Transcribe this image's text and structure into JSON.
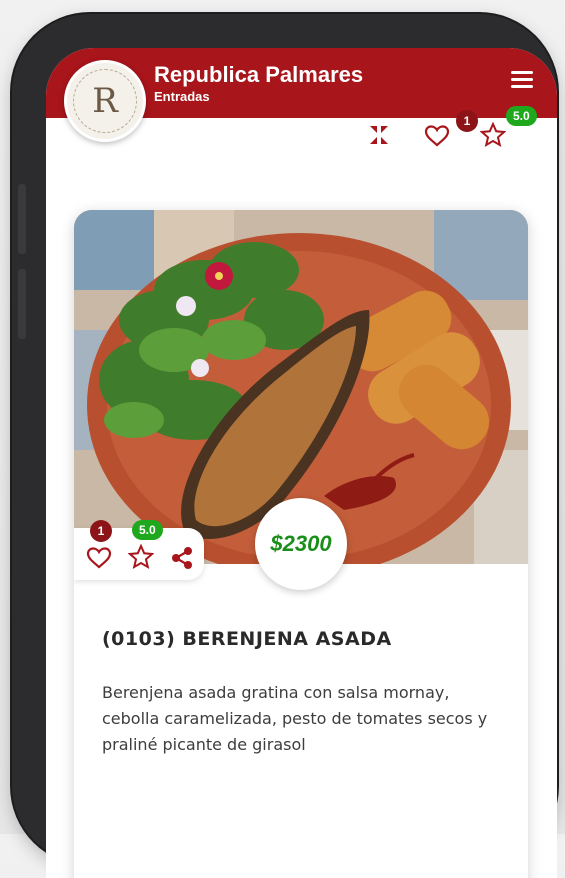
{
  "header": {
    "logo_letter": "R",
    "title": "Republica Palmares",
    "subtitle": "Entradas"
  },
  "toolbar": {
    "favorites_count": "1",
    "rating": "5.0"
  },
  "product": {
    "favorites_count": "1",
    "rating": "5.0",
    "price": "$2300",
    "title": "(0103) BERENJENA ASADA",
    "description": "Berenjena asada gratina con salsa mornay, cebolla caramelizada, pesto de tomates secos y praliné picante de girasol"
  },
  "colors": {
    "header_bg": "#a8151b",
    "accent_red": "#a8151b",
    "badge_green": "#1fa81e",
    "price_green": "#1a8e1a"
  },
  "icons": [
    "menu-icon",
    "collapse-icon",
    "heart-icon",
    "star-icon",
    "share-icon"
  ]
}
